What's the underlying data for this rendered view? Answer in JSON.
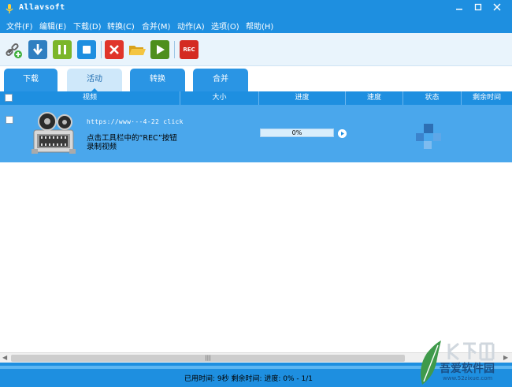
{
  "window": {
    "title": "Allavsoft"
  },
  "menu": {
    "items": [
      "文件(F)",
      "编辑(E)",
      "下载(D)",
      "转换(C)",
      "合并(M)",
      "动作(A)",
      "选项(O)",
      "帮助(H)"
    ]
  },
  "toolbar": {
    "buttons": [
      "link-add-icon",
      "download-icon",
      "pause-icon",
      "stop-icon",
      "delete-icon",
      "folder-icon",
      "play-icon",
      "record-icon"
    ],
    "rec_label": "REC"
  },
  "tabs": [
    "下载",
    "活动",
    "转换",
    "合并"
  ],
  "columns": [
    "视频",
    "大小",
    "进度",
    "速度",
    "状态",
    "剩余时间"
  ],
  "row": {
    "url": "https://www·--4-22 click",
    "hint_line1": "点击工具栏中的“REC”按钮",
    "hint_line2": "录制视频",
    "progress": "0%",
    "progress_value": 0
  },
  "hscroll_grip": "|||",
  "status": {
    "text": "已用时间:  9秒  剩余时间:  进度:  0% - 1/1"
  },
  "watermark": {
    "brand": "吾爱软件园",
    "url": "www.52zixue.com"
  },
  "colors": {
    "titlebar": "#1e8fe0",
    "row_bg": "#4aa7ec",
    "tab_active": "#cfe8fa"
  }
}
